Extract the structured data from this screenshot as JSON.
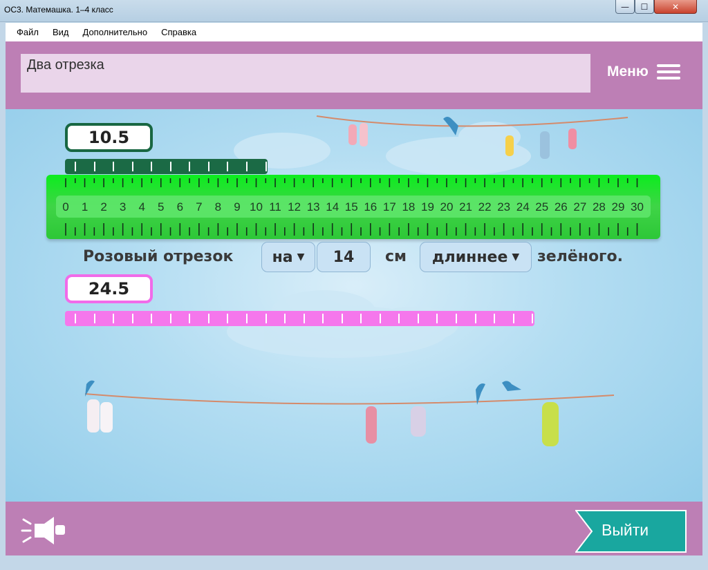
{
  "window": {
    "title": "ОС3. Матемашка. 1–4 класс",
    "controls": {
      "minimize": "—",
      "maximize": "☐",
      "close": "✕"
    }
  },
  "menubar": {
    "items": [
      "Файл",
      "Вид",
      "Дополнительно",
      "Справка"
    ]
  },
  "header": {
    "task_title": "Два отрезка",
    "menu_label": "Меню"
  },
  "task": {
    "green_segment": {
      "value": "10.5",
      "color": "#1b6a45",
      "border_color": "#186742"
    },
    "pink_segment": {
      "value": "24.5",
      "color": "#f577ec",
      "border_color": "#f16be9"
    },
    "ruler": {
      "min": 0,
      "max": 30,
      "labels": [
        "0",
        "1",
        "2",
        "3",
        "4",
        "5",
        "6",
        "7",
        "8",
        "9",
        "10",
        "11",
        "12",
        "13",
        "14",
        "15",
        "16",
        "17",
        "18",
        "19",
        "20",
        "21",
        "22",
        "23",
        "24",
        "25",
        "26",
        "27",
        "28",
        "29",
        "30"
      ]
    },
    "sentence": {
      "subject": "Розовый отрезок",
      "dropdown_na": "на",
      "difference_value": "14",
      "unit": "см",
      "comparison": "длиннее",
      "object": "зелёного."
    }
  },
  "footer": {
    "sound_icon": "sound-icon",
    "exit_label": "Выйти",
    "accent": "#19a79f"
  },
  "colors": {
    "header_bg": "#bd7fb5",
    "task_box_bg": "#ead5ea",
    "ruler": "#2dc737"
  }
}
